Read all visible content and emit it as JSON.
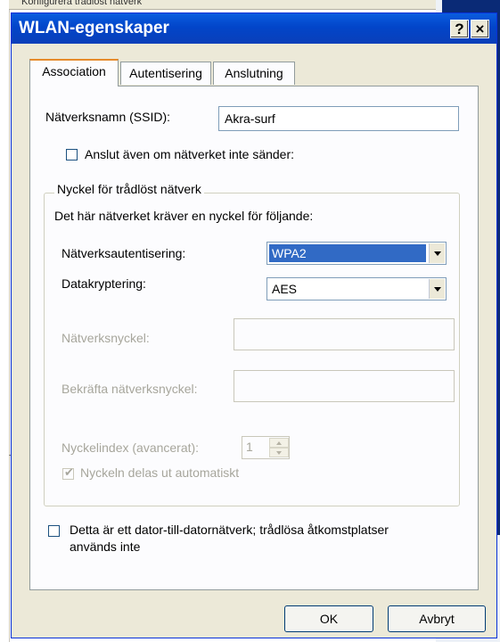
{
  "background": {
    "top_text": "Konfigurera trådlöst nätverk"
  },
  "window": {
    "title": "WLAN-egenskaper",
    "help_label": "?",
    "close_label": "×"
  },
  "tabs": [
    {
      "label": "Association",
      "active": true
    },
    {
      "label": "Autentisering",
      "active": false
    },
    {
      "label": "Anslutning",
      "active": false
    }
  ],
  "ssid": {
    "label": "Nätverksnamn (SSID):",
    "value": "Akra-surf"
  },
  "broadcast_check": {
    "label": "Anslut även om nätverket inte sänder:",
    "checked": false
  },
  "key_group": {
    "title": "Nyckel för trådlöst nätverk",
    "description": "Det här nätverket kräver en nyckel för följande:",
    "auth": {
      "label": "Nätverksautentisering:",
      "value": "WPA2"
    },
    "encryption": {
      "label": "Datakryptering:",
      "value": "AES"
    },
    "network_key": {
      "label": "Nätverksnyckel:",
      "value": ""
    },
    "confirm_key": {
      "label": "Bekräfta nätverksnyckel:",
      "value": ""
    },
    "key_index": {
      "label": "Nyckelindex (avancerat):",
      "value": "1"
    },
    "auto_key": {
      "label": "Nyckeln delas ut automatiskt",
      "checked": true
    }
  },
  "adhoc_check": {
    "label_line1": "Detta är ett dator-till-datornätverk; trådlösa åtkomstplatser",
    "label_line2": "används inte",
    "checked": false
  },
  "buttons": {
    "ok": "OK",
    "cancel": "Avbryt"
  },
  "colors": {
    "titlebar": "#0245c9",
    "selection": "#316ac5",
    "window_bg": "#ece9d8"
  }
}
